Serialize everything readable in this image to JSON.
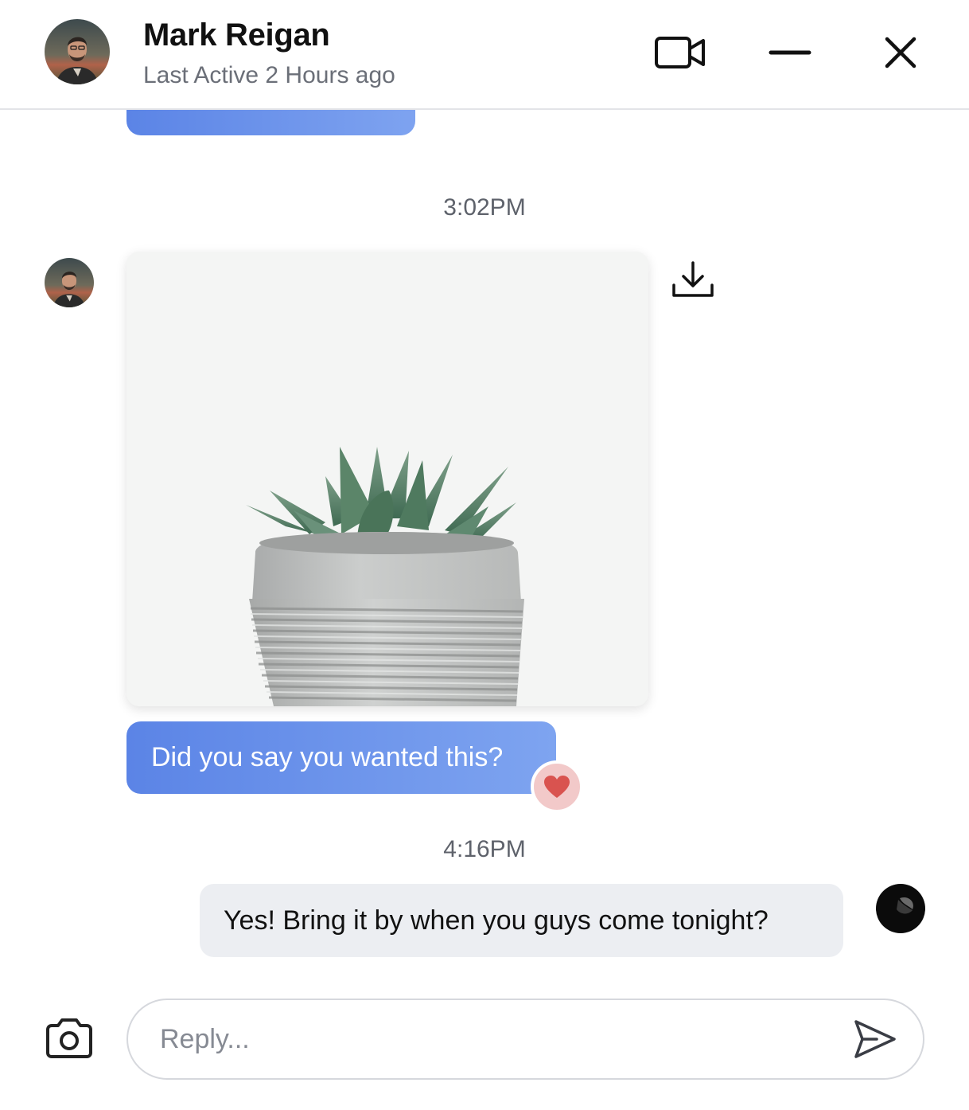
{
  "header": {
    "contact_name": "Mark Reigan",
    "status": "Last Active 2 Hours ago",
    "icons": {
      "video_call": "video-camera-icon",
      "minimize": "minus-icon",
      "close": "close-icon"
    }
  },
  "messages": {
    "timestamp_1": "3:02PM",
    "timestamp_2": "4:16PM",
    "incoming_text": "Did you say you wanted this?",
    "reaction": "heart",
    "outgoing_text": "Yes! Bring it by when you guys come tonight?"
  },
  "composer": {
    "placeholder": "Reply...",
    "value": "",
    "icons": {
      "camera": "camera-icon",
      "send": "send-icon"
    }
  },
  "colors": {
    "bubble_in_start": "#5b84e6",
    "bubble_in_end": "#7ea4f0",
    "bubble_out": "#eceef2",
    "reaction_bg": "#f2c9c9",
    "heart": "#d9534f"
  }
}
